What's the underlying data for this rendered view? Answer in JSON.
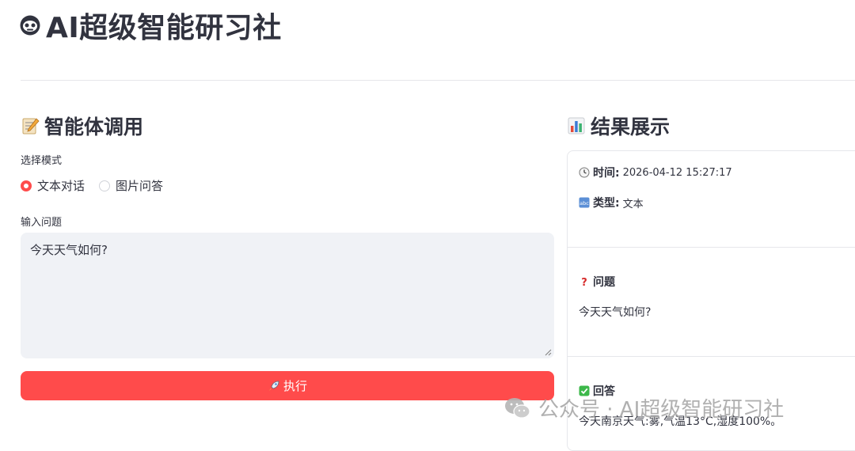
{
  "app": {
    "title": "AI超级智能研习社"
  },
  "left": {
    "heading": "智能体调用",
    "mode_label": "选择模式",
    "modes": [
      {
        "label": "文本对话",
        "selected": true
      },
      {
        "label": "图片问答",
        "selected": false
      }
    ],
    "question_label": "输入问题",
    "question_value": "今天天气如何?",
    "run_button": "执行"
  },
  "right": {
    "heading": "结果展示",
    "time_label": "时间:",
    "time_value": "2026-04-12 15:27:17",
    "type_label": "类型:",
    "type_value": "文本",
    "question_heading": "问题",
    "question_text": "今天天气如何?",
    "answer_heading": "回答",
    "answer_text": "今天南京天气:雾,气温13°C,湿度100%。"
  },
  "watermark": {
    "text": "公众号 · AI超级智能研习社"
  },
  "colors": {
    "accent": "#ff4b4b",
    "text": "#31333f",
    "input_bg": "#f0f2f6",
    "border": "#e6e7eb"
  }
}
